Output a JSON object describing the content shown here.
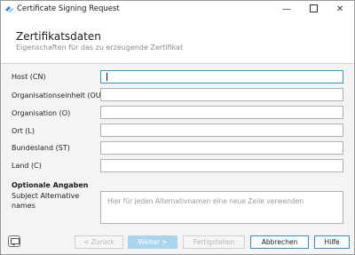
{
  "window": {
    "title": "Certificate Signing Request",
    "controls": {
      "minimize": "—",
      "close": "✕"
    }
  },
  "header": {
    "title": "Zertifikatsdaten",
    "subtitle": "Eigenschaften für das zu erzeugende Zertifikat"
  },
  "form": {
    "fields": [
      {
        "label": "Host (CN)",
        "value": ""
      },
      {
        "label": "Organisationseinheit (OU)",
        "value": ""
      },
      {
        "label": "Organisation (O)",
        "value": ""
      },
      {
        "label": "Ort (L)",
        "value": ""
      },
      {
        "label": "Bundesland (ST)",
        "value": ""
      },
      {
        "label": "Land (C)",
        "value": ""
      }
    ],
    "optional_section": "Optionale Angaben",
    "san": {
      "label": "Subject Alternative names",
      "placeholder": "Hier für jeden Alternativnamen eine neue Zeile verwenden",
      "value": ""
    }
  },
  "footer": {
    "back": "< Zurück",
    "next": "Weiter >",
    "finish": "Fertigstellen",
    "cancel": "Abbrechen",
    "help": "Hilfe"
  },
  "colors": {
    "accent": "#3c9ac6",
    "next_button_bg": "#a9d5ee",
    "focus_border": "#3c9ac6"
  }
}
